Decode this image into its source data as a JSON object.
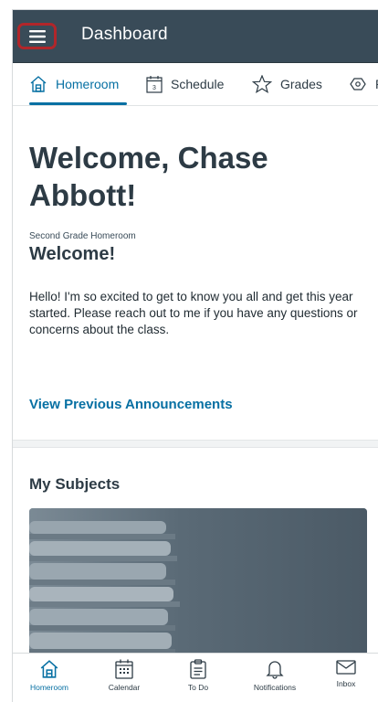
{
  "header": {
    "title": "Dashboard",
    "menu_icon": "hamburger-menu-icon",
    "bar_color": "#394b58",
    "highlight_color": "#b1262a"
  },
  "tabs": [
    {
      "label": "Homeroom",
      "icon": "home-icon",
      "active": true
    },
    {
      "label": "Schedule",
      "icon": "calendar-icon",
      "active": false
    },
    {
      "label": "Grades",
      "icon": "star-icon",
      "active": false
    },
    {
      "label": "R",
      "icon": "resources-icon",
      "active": false
    }
  ],
  "main": {
    "welcome_title": "Welcome, Chase Abbott!",
    "homeroom_label": "Second Grade Homeroom",
    "welcome_subtitle": "Welcome!",
    "message": "Hello! I'm so excited to get to know you all and get this year started. Please reach out to me if you have any questions or concerns about the class.",
    "view_announcements": "View Previous Announcements",
    "subjects_title": "My Subjects"
  },
  "bottom_nav": [
    {
      "label": "Homeroom",
      "icon": "home-icon",
      "active": true
    },
    {
      "label": "Calendar",
      "icon": "calendar-icon",
      "active": false
    },
    {
      "label": "To Do",
      "icon": "clipboard-icon",
      "active": false
    },
    {
      "label": "Notifications",
      "icon": "bell-icon",
      "active": false
    },
    {
      "label": "Inbox",
      "icon": "envelope-icon",
      "active": false
    }
  ],
  "colors": {
    "accent": "#0770a3",
    "text": "#2d3b45"
  }
}
